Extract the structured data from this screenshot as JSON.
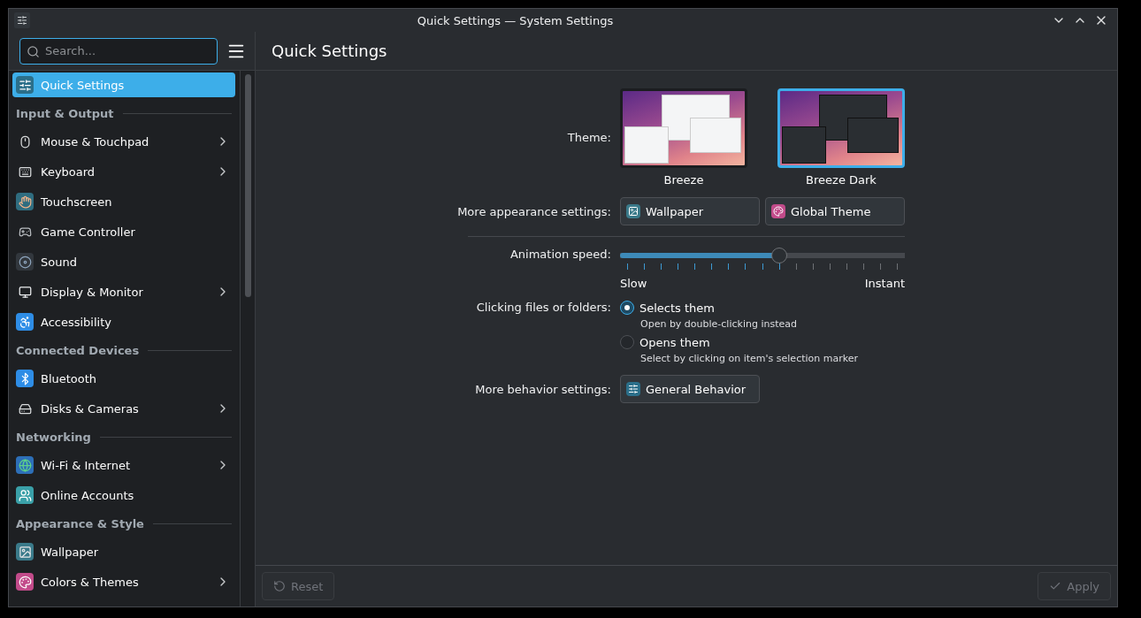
{
  "window": {
    "title": "Quick Settings — System Settings"
  },
  "sidebar": {
    "search": {
      "placeholder": "Search..."
    },
    "top_items": [
      {
        "label": "Quick Settings",
        "selected": true,
        "has_submenu": false
      }
    ],
    "sections": [
      {
        "title": "Input & Output",
        "items": [
          {
            "label": "Mouse & Touchpad",
            "selected": false,
            "has_submenu": true
          },
          {
            "label": "Keyboard",
            "selected": false,
            "has_submenu": true
          },
          {
            "label": "Touchscreen",
            "selected": false,
            "has_submenu": false
          },
          {
            "label": "Game Controller",
            "selected": false,
            "has_submenu": false
          },
          {
            "label": "Sound",
            "selected": false,
            "has_submenu": false
          },
          {
            "label": "Display & Monitor",
            "selected": false,
            "has_submenu": true
          },
          {
            "label": "Accessibility",
            "selected": false,
            "has_submenu": false
          }
        ]
      },
      {
        "title": "Connected Devices",
        "items": [
          {
            "label": "Bluetooth",
            "selected": false,
            "has_submenu": false
          },
          {
            "label": "Disks & Cameras",
            "selected": false,
            "has_submenu": true
          }
        ]
      },
      {
        "title": "Networking",
        "items": [
          {
            "label": "Wi-Fi & Internet",
            "selected": false,
            "has_submenu": true
          },
          {
            "label": "Online Accounts",
            "selected": false,
            "has_submenu": false
          }
        ]
      },
      {
        "title": "Appearance & Style",
        "items": [
          {
            "label": "Wallpaper",
            "selected": false,
            "has_submenu": false
          },
          {
            "label": "Colors & Themes",
            "selected": false,
            "has_submenu": true
          }
        ]
      }
    ]
  },
  "page": {
    "title": "Quick Settings",
    "theme": {
      "label": "Theme:",
      "options": [
        {
          "name": "Breeze",
          "kind": "light",
          "selected": false
        },
        {
          "name": "Breeze Dark",
          "kind": "dark",
          "selected": true
        }
      ]
    },
    "appearance": {
      "label": "More appearance settings:",
      "buttons": [
        "Wallpaper",
        "Global Theme"
      ]
    },
    "animation": {
      "label": "Animation speed:",
      "level": 0.5625,
      "min_label": "Slow",
      "max_label": "Instant"
    },
    "clicking": {
      "label": "Clicking files or folders:",
      "options": [
        {
          "label": "Selects them",
          "hint": "Open by double-clicking instead",
          "selected": true
        },
        {
          "label": "Opens them",
          "hint": "Select by clicking on item's selection marker",
          "selected": false
        }
      ]
    },
    "behavior": {
      "label": "More behavior settings:",
      "buttons": [
        "General Behavior"
      ]
    }
  },
  "footer": {
    "buttons": [
      {
        "kind": "reset",
        "label": "Reset",
        "disabled": true
      },
      {
        "kind": "apply",
        "label": "Apply",
        "disabled": true
      }
    ]
  }
}
